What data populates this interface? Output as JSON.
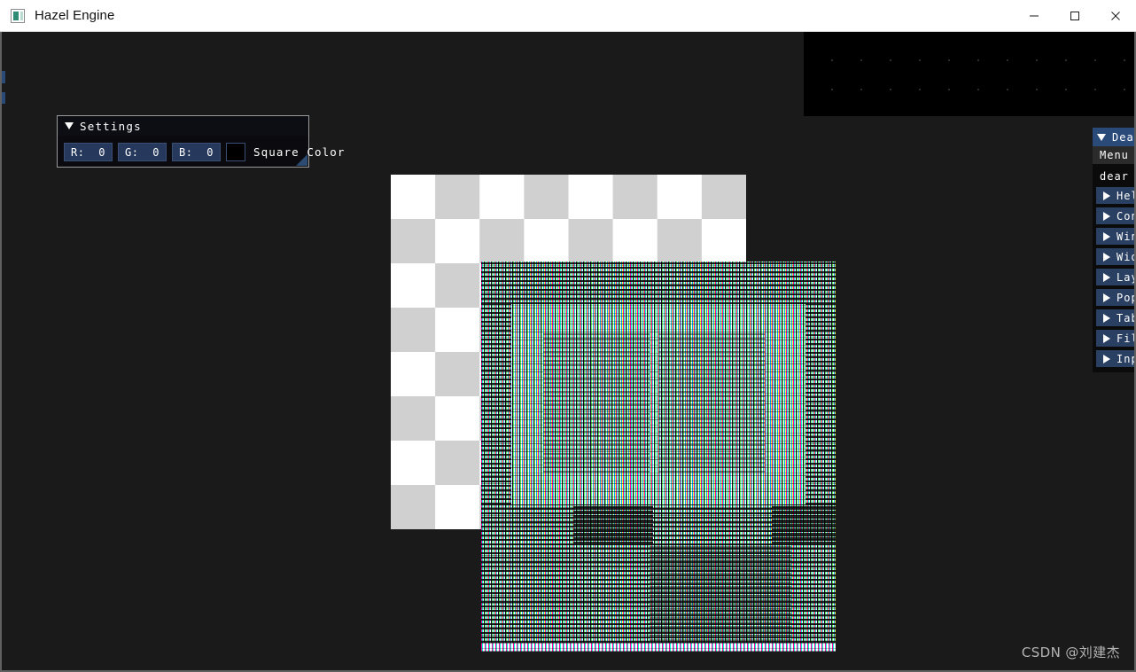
{
  "window": {
    "title": "Hazel Engine",
    "icon": "hazel-app-icon",
    "controls": [
      {
        "name": "minimize",
        "glyph": "minimize-icon"
      },
      {
        "name": "maximize",
        "glyph": "maximize-icon"
      },
      {
        "name": "close",
        "glyph": "close-icon"
      }
    ]
  },
  "viewport": {
    "background_color": "#1a1a1a",
    "border_color": "#606060",
    "checkerboard": {
      "name": "checkerboard-texture",
      "color_a": "#ffffff",
      "color_b": "#d0d0d0",
      "cell_size_px": 50
    },
    "noise_quad": {
      "name": "corrupted-texture-quad",
      "description": "garbled RGB stripe texture"
    },
    "dark_grid": {
      "name": "dark-tile-grid",
      "cell_color": "#000000",
      "gap_color": "#2b2b2b",
      "cell_size_px": 31
    }
  },
  "settings_panel": {
    "title": "Settings",
    "collapse_icon": "triangle-down-icon",
    "drags": [
      {
        "label": "R:",
        "value": "0"
      },
      {
        "label": "G:",
        "value": "0"
      },
      {
        "label": "B:",
        "value": "0"
      }
    ],
    "color_edit": {
      "label": "Square Color",
      "swatch_color": "#000000"
    },
    "resize_grip_icon": "resize-grip-icon"
  },
  "demo_panel": {
    "title": "Dear",
    "collapse_icon": "triangle-down-icon",
    "menubar": {
      "menu_label": "Menu"
    },
    "intro_text": "dear im",
    "tree_nodes": [
      {
        "label": "Hel",
        "arrow": "triangle-right-icon"
      },
      {
        "label": "Con",
        "arrow": "triangle-right-icon"
      },
      {
        "label": "Win",
        "arrow": "triangle-right-icon"
      },
      {
        "label": "Wid",
        "arrow": "triangle-right-icon"
      },
      {
        "label": "Lay",
        "arrow": "triangle-right-icon"
      },
      {
        "label": "Pop",
        "arrow": "triangle-right-icon"
      },
      {
        "label": "Tab",
        "arrow": "triangle-right-icon"
      },
      {
        "label": "Fil",
        "arrow": "triangle-right-icon"
      },
      {
        "label": "Inp",
        "arrow": "triangle-right-icon"
      }
    ]
  },
  "watermark": {
    "text": "CSDN @刘建杰"
  }
}
